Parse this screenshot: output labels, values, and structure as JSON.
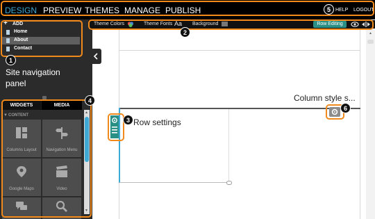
{
  "nav": {
    "items": [
      "DESIGN",
      "PREVIEW",
      "THEMES",
      "MANAGE",
      "PUBLISH"
    ],
    "help": "HELP",
    "logout": "LOGOUT"
  },
  "sidebar": {
    "add_label": "ADD",
    "pages": [
      "Home",
      "About",
      "Contact"
    ],
    "selected_page": "About",
    "annotation": "Site navigation panel"
  },
  "toolbar": {
    "theme_colors": "Theme Colors",
    "theme_fonts": "Theme Fonts",
    "fonts_glyph": "Aa",
    "background": "Background",
    "row_editing": "Row Editing"
  },
  "widgets_panel": {
    "tabs": [
      "WIDGETS",
      "MEDIA"
    ],
    "section": "CONTENT",
    "items": [
      {
        "label": "Columns Layout",
        "icon": "columns-layout-icon"
      },
      {
        "label": "Navigation Menu",
        "icon": "navigation-menu-icon"
      },
      {
        "label": "Google Maps",
        "icon": "map-pin-icon"
      },
      {
        "label": "Video",
        "icon": "video-clapper-icon"
      },
      {
        "label": "",
        "icon": "chat-bubbles-icon"
      },
      {
        "label": "",
        "icon": "search-icon"
      }
    ]
  },
  "canvas": {
    "row_settings_label": "Row settings",
    "column_style_label": "Column style s..."
  },
  "badges": [
    "1",
    "2",
    "3",
    "4",
    "5",
    "6"
  ],
  "colors": {
    "accent": "#f08a1c",
    "active_nav": "#3fa9d6",
    "row_editing_bg": "#2a8f85",
    "selection_blue": "#3fa9d6"
  }
}
